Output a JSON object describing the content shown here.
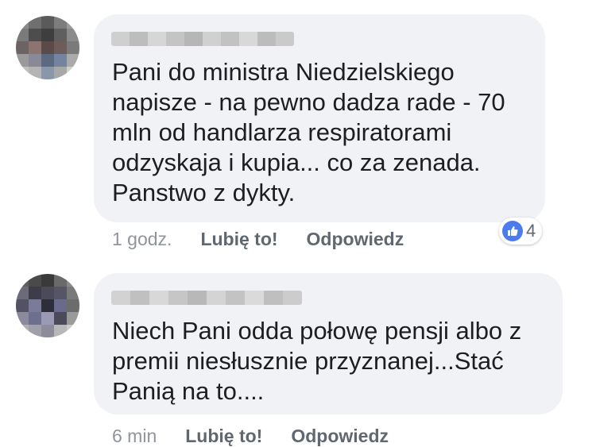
{
  "comments": [
    {
      "text": "Pani do ministra Niedzielskiego\nnapisze - na pewno dadza rade - 70\nmln od handlarza respiratorami\nodzyskaja i kupia... co za zenada.\nPanstwo z dykty.",
      "time": "1 godz.",
      "like_label": "Lubię to!",
      "reply_label": "Odpowiedz",
      "reaction_icon": "thumbs-up-icon",
      "reaction_count": "4"
    },
    {
      "text": "Niech Pani odda  połowę pensji albo z\npremii niesłusznie przyznanej...Stać\nPanią na to....",
      "time": "6 min",
      "like_label": "Lubię to!",
      "reply_label": "Odpowiedz"
    }
  ],
  "colors": {
    "bubble": "#f1f2f6",
    "text": "#1c1e21",
    "meta": "#90949c",
    "link": "#606770",
    "like_blue": "#4b7bec"
  }
}
